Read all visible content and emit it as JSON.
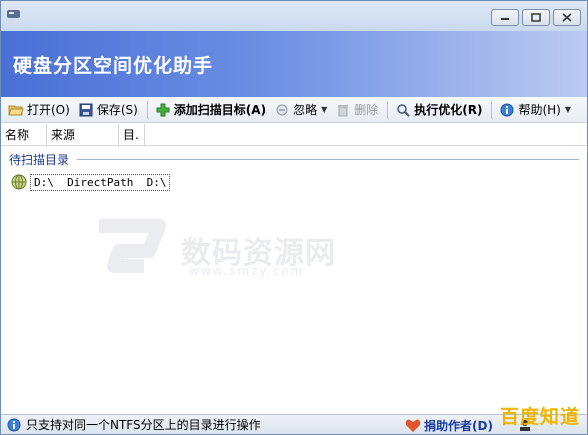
{
  "window": {
    "title": "",
    "banner_title": "硬盘分区空间优化助手"
  },
  "toolbar": {
    "items": [
      {
        "label": "打开(O)",
        "icon": "folder-open-icon"
      },
      {
        "label": "保存(S)",
        "icon": "save-disk-icon"
      },
      {
        "label": "添加扫描目标(A)",
        "icon": "plus-icon",
        "bold": true
      },
      {
        "label": "忽略",
        "icon": "ignore-icon",
        "dropdown": true
      },
      {
        "label": "删除",
        "icon": "trash-icon",
        "disabled": true
      },
      {
        "label": "执行优化(R)",
        "icon": "magnifier-icon",
        "bold": true
      },
      {
        "label": "帮助(H)",
        "icon": "info-icon",
        "dropdown": true
      }
    ]
  },
  "list": {
    "columns": [
      "名称",
      "来源",
      "目."
    ],
    "group_label": "待扫描目录",
    "rows": [
      {
        "text": "D:\\  DirectPath  D:\\",
        "icon": "globe-icon"
      }
    ]
  },
  "watermark": {
    "text": "数码资源网",
    "url": "www.smzy.com"
  },
  "statusbar": {
    "message": "只支持对同一个NTFS分区上的目录进行操作",
    "donate_label": "捐助作者(D)",
    "tail_text": "",
    "colors": {
      "donate": "#1a3fa0",
      "heart": "#e0562a"
    }
  },
  "overlay_logo": {
    "text": "百度知道"
  },
  "colors": {
    "banner_start": "#4a6fd6",
    "banner_end": "#bccaf0",
    "group_text": "#1e3a8a"
  }
}
